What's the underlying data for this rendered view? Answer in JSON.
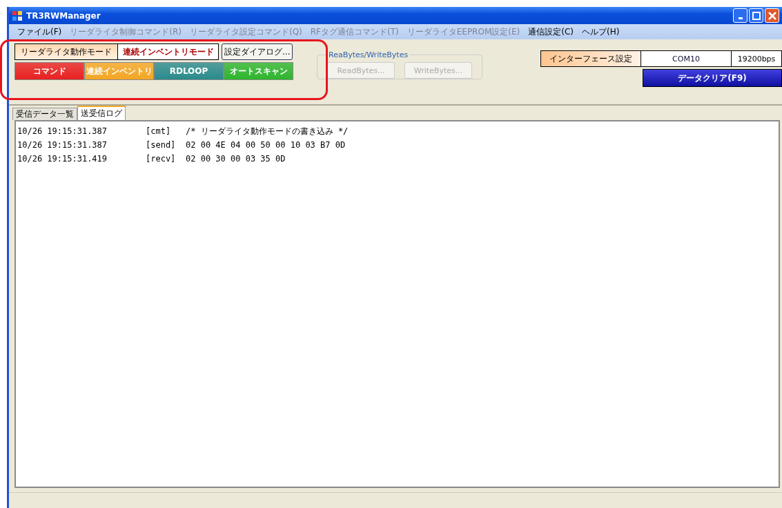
{
  "window": {
    "title": "TR3RWManager"
  },
  "menu": [
    {
      "label": "ファイル(F)",
      "disabled": false
    },
    {
      "label": "リーダライタ制御コマンド(R)",
      "disabled": true
    },
    {
      "label": "リーダライタ設定コマンド(Q)",
      "disabled": true
    },
    {
      "label": "RFタグ通信コマンド(T)",
      "disabled": true
    },
    {
      "label": "リーダライタEEPROM設定(E)",
      "disabled": true
    },
    {
      "label": "通信設定(C)",
      "disabled": false
    },
    {
      "label": "ヘルプ(H)",
      "disabled": false
    }
  ],
  "mode": {
    "label": "リーダライタ動作モード",
    "value": "連続インベントリモード",
    "dialog_button": "設定ダイアログ..."
  },
  "mode_buttons": [
    {
      "label": "コマンド",
      "color": "#e82020"
    },
    {
      "label": "連続インベントリ",
      "color": "#f5a623"
    },
    {
      "label": "RDLOOP",
      "color": "#2a8a8c"
    },
    {
      "label": "オートスキャン",
      "color": "#2db52d"
    }
  ],
  "bytes_group": {
    "title": "ReaBytes/WriteBytes",
    "buttons": [
      {
        "label": "ReadBytes...",
        "disabled": true
      },
      {
        "label": "WriteBytes...",
        "disabled": true
      }
    ]
  },
  "interface": {
    "label": "インターフェース設定",
    "port": "COM10",
    "baud": "19200bps",
    "clear_button": "データクリア(F9)"
  },
  "tabs": [
    {
      "label": "受信データ一覧",
      "selected": false
    },
    {
      "label": "送受信ログ",
      "selected": true
    }
  ],
  "log": [
    {
      "time": "10/26 19:15:31.387",
      "type": "[cmt]",
      "text": "/* リーダライタ動作モードの書き込み */"
    },
    {
      "time": "10/26 19:15:31.387",
      "type": "[send]",
      "text": "02 00 4E 04 00 50 00 10 03 B7 0D"
    },
    {
      "time": "10/26 19:15:31.419",
      "type": "[recv]",
      "text": "02 00 30 00 03 35 0D"
    }
  ]
}
